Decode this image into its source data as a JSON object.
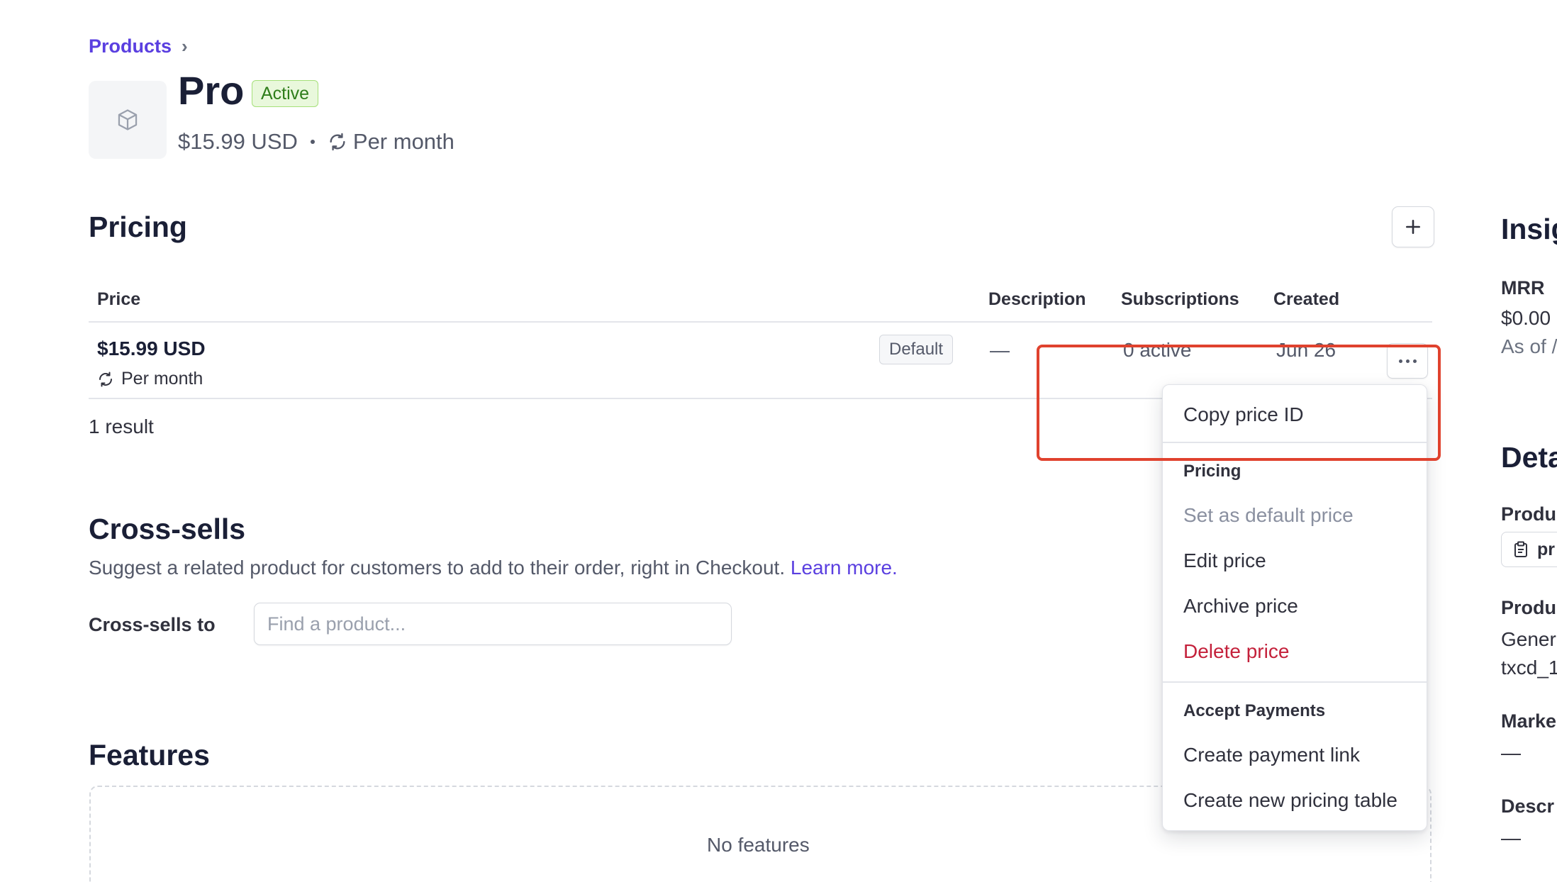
{
  "breadcrumb": {
    "label": "Products",
    "separator": "›"
  },
  "product": {
    "name": "Pro",
    "status": "Active",
    "price": "$15.99 USD",
    "interval": "Per month"
  },
  "pricing": {
    "title": "Pricing",
    "columns": [
      "Price",
      "Description",
      "Subscriptions",
      "Created"
    ],
    "rows": [
      {
        "price": "$15.99 USD",
        "interval": "Per month",
        "badge": "Default",
        "description": "—",
        "subscriptions": "0 active",
        "created": "Jun 26"
      }
    ],
    "result_count": "1 result"
  },
  "cross_sells": {
    "title": "Cross-sells",
    "description": "Suggest a related product for customers to add to their order, right in Checkout.",
    "learn_more": "Learn more.",
    "label": "Cross-sells to",
    "placeholder": "Find a product..."
  },
  "features": {
    "title": "Features",
    "empty": "No features"
  },
  "sidebar": {
    "insights_title": "Insig",
    "mrr_label": "MRR",
    "mrr_value": "$0.00",
    "mrr_note": "As of /",
    "details_title": "Deta",
    "product_id_label": "Produ",
    "product_id_chip": "pr",
    "tax_label": "Produ",
    "tax_value_1": "Gener",
    "tax_value_2": "txcd_1",
    "marketing_label": "Marke",
    "marketing_value": "—",
    "description_label": "Descr",
    "description_value": "—"
  },
  "menu": {
    "copy_price_id": "Copy price ID",
    "pricing_header": "Pricing",
    "set_default": "Set as default price",
    "edit_price": "Edit price",
    "archive_price": "Archive price",
    "delete_price": "Delete price",
    "payments_header": "Accept Payments",
    "create_payment_link": "Create payment link",
    "create_pricing_table": "Create new pricing table"
  },
  "colors": {
    "accent": "#5a3fe0",
    "danger": "#c4213b",
    "active_bg": "#e9f8dc",
    "highlight": "#e0422e"
  },
  "icons": [
    "chevron-right-icon",
    "box-icon",
    "recurring-icon",
    "plus-icon",
    "more-horizontal-icon",
    "clipboard-icon"
  ]
}
